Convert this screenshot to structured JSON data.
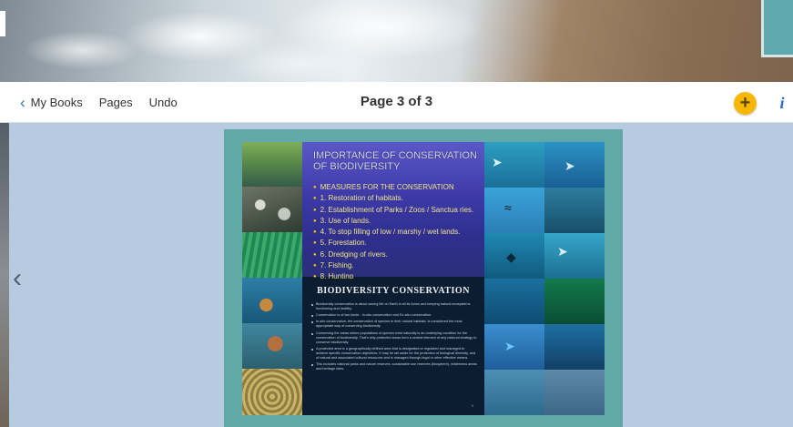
{
  "toolbar": {
    "back_label": "My Books",
    "pages_label": "Pages",
    "undo_label": "Undo",
    "page_indicator": "Page 3 of 3",
    "add_icon": "plus-icon",
    "info_icon": "info-icon",
    "accent_color": "#f6b700",
    "link_color": "#2a6cc8"
  },
  "navigation": {
    "prev_icon": "chevron-left-icon"
  },
  "slide": {
    "upper": {
      "title_line1": "IMPORTANCE OF CONSERVATION",
      "title_line2": "OF BIODIVERSITY",
      "items": [
        "MEASURES FOR THE CONSERVATION",
        "1. Restoration of habitats.",
        "2. Establishment of Parks / Zoos / Sanctua ries.",
        "3. Use of lands.",
        "4. To stop filling of low / marshy / wet lands.",
        "5. Forestation.",
        "6. Dredging of rivers.",
        "7. Fishing.",
        "8. Hunting"
      ]
    },
    "lower": {
      "title": "BIODIVERSITY CONSERVATION",
      "paragraphs": [
        "Biodiversity conservation is about saving life on Earth in all its forms and keeping natural ecosystems functioning and healthy.",
        "Conservation is of two kinds - In-situ conservation and Ex-situ conservation.",
        "In-situ conservation, the conservation of species in their natural habitats, is considered the most appropriate way of conserving biodiversity.",
        "Conserving the areas where populations of species exist naturally is an underlying condition for the conservation of biodiversity. That's why protected areas form a central element of any national strategy to conserve biodiversity.",
        "A protected area is a geographically defined area that is designated or regulated and managed to achieve specific conservation objectives. It may be set aside for the protection of biological diversity, and of natural and associated cultural resources and is managed through legal or other effective means.",
        "This includes national parks and nature reserves, sustainable use reserves (biosphere), wilderness areas and heritage sites."
      ],
      "page_number": "9"
    }
  }
}
